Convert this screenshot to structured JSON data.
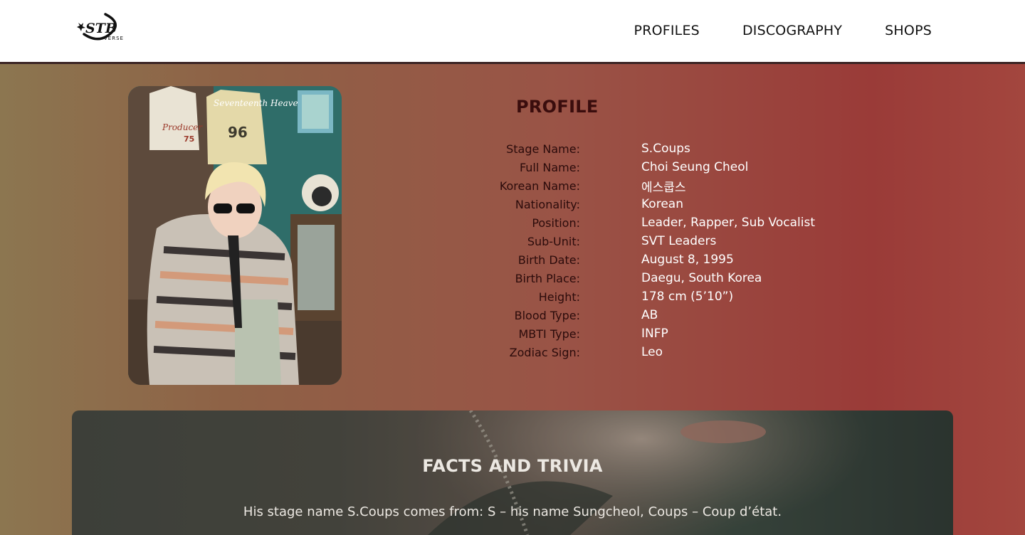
{
  "brand": {
    "logo_text": "STB",
    "logo_sub": "VERSE"
  },
  "nav": {
    "items": [
      {
        "label": "PROFILES"
      },
      {
        "label": "DISCOGRAPHY"
      },
      {
        "label": "SHOPS"
      }
    ]
  },
  "profile": {
    "title": "PROFILE",
    "photo": {
      "caption_text": "Seventeenth Heaven",
      "jersey_number": "96",
      "jersey_word": "Producer",
      "jersey_number_2": "75"
    },
    "rows": [
      {
        "label": "Stage Name:",
        "value": "S.Coups"
      },
      {
        "label": "Full Name:",
        "value": "Choi Seung Cheol"
      },
      {
        "label": "Korean Name:",
        "value": "에스쿱스"
      },
      {
        "label": "Nationality:",
        "value": "Korean"
      },
      {
        "label": "Position:",
        "value": "Leader, Rapper, Sub Vocalist"
      },
      {
        "label": "Sub-Unit:",
        "value": "SVT Leaders"
      },
      {
        "label": "Birth Date:",
        "value": "August 8, 1995"
      },
      {
        "label": "Birth Place:",
        "value": "Daegu, South Korea"
      },
      {
        "label": "Height:",
        "value": "178 cm (5’10”)"
      },
      {
        "label": "Blood Type:",
        "value": "AB"
      },
      {
        "label": "MBTI Type:",
        "value": "INFP"
      },
      {
        "label": "Zodiac Sign:",
        "value": "Leo"
      }
    ]
  },
  "facts": {
    "title": "FACTS AND TRIVIA",
    "text": "His stage name S.Coups comes from: S – his name Sungcheol, Coups – Coup d’état."
  },
  "colors": {
    "header_bg": "#ffffff",
    "hero_left": "#8c7650",
    "hero_right": "#9a3b38",
    "label_color": "#2b0b0b",
    "title_color": "#3a0d0d",
    "value_color": "#ffffff"
  }
}
